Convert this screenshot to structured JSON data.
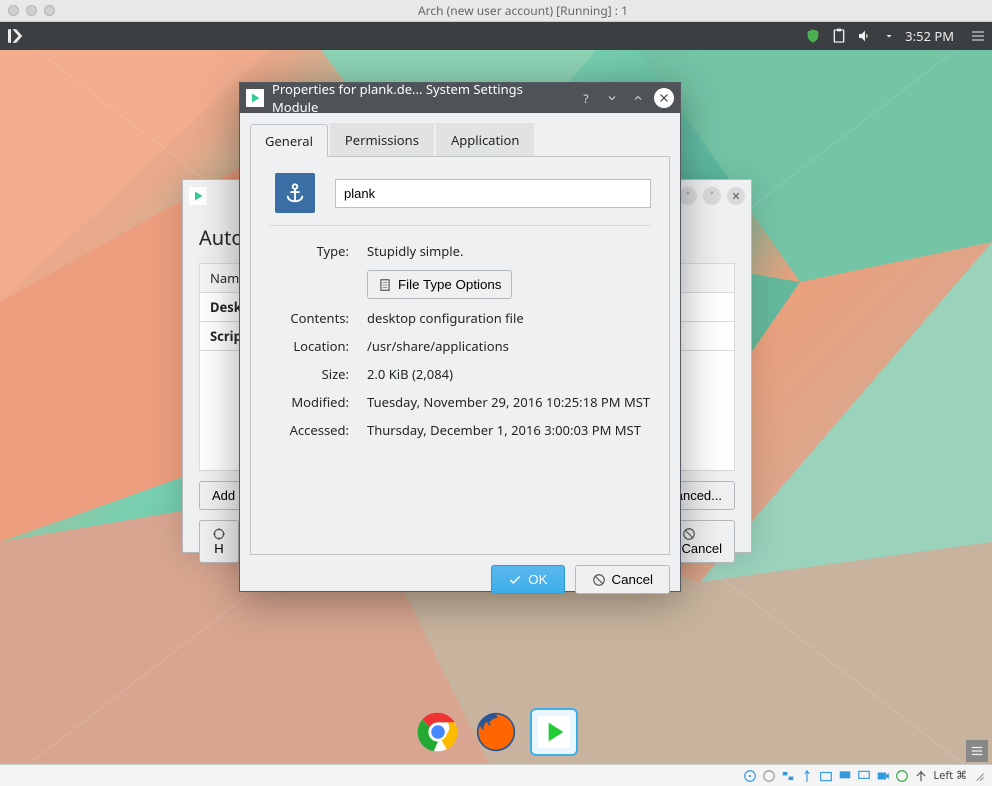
{
  "mac": {
    "title": "Arch (new user account) [Running] : 1"
  },
  "panel": {
    "clock": "3:52 PM"
  },
  "autostart": {
    "title_visible": "Auto",
    "columns": {
      "name": "Name"
    },
    "rows": [
      {
        "col1": "Deskt"
      },
      {
        "col1": "Script"
      }
    ],
    "buttons": {
      "add": "Add P",
      "h": "H",
      "advanced": "vanced...",
      "cancel": "Cancel"
    }
  },
  "properties": {
    "title": "Properties for plank.de... System Settings Module",
    "tabs": {
      "general": "General",
      "permissions": "Permissions",
      "application": "Application"
    },
    "name_value": "plank",
    "labels": {
      "type": "Type:",
      "contents": "Contents:",
      "location": "Location:",
      "size": "Size:",
      "modified": "Modified:",
      "accessed": "Accessed:"
    },
    "values": {
      "type": "Stupidly simple.",
      "filetype_btn": "File Type Options",
      "contents": "desktop configuration file",
      "location": "/usr/share/applications",
      "size": "2.0 KiB (2,084)",
      "modified": "Tuesday, November 29, 2016 10:25:18 PM MST",
      "accessed": "Thursday, December 1, 2016 3:00:03 PM MST"
    },
    "footer": {
      "ok": "OK",
      "cancel": "Cancel"
    }
  },
  "vmbar": {
    "host": "Left ⌘"
  }
}
